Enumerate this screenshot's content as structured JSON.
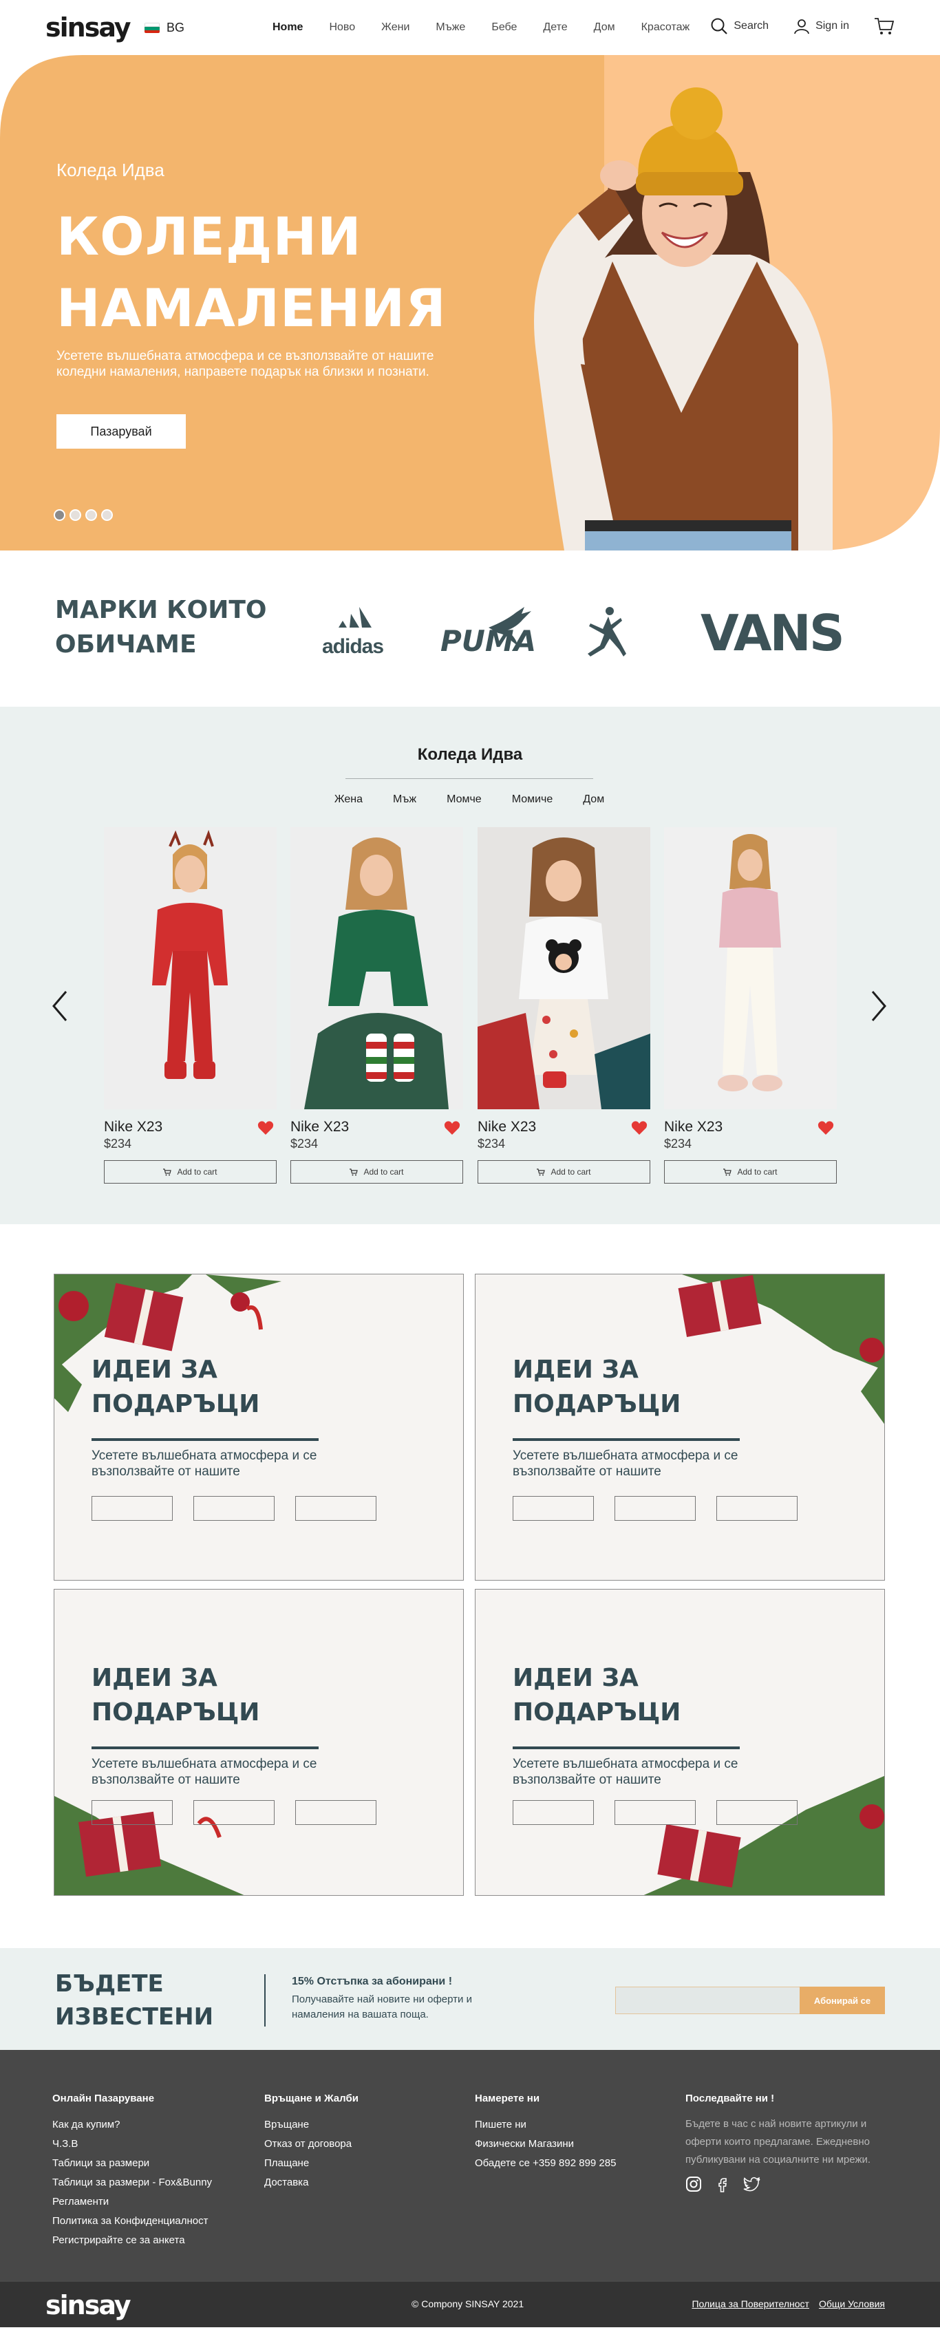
{
  "header": {
    "logo": "sinsay",
    "lang": "BG",
    "nav": [
      "Home",
      "Ново",
      "Жени",
      "Мъже",
      "Бебе",
      "Дете",
      "Дом",
      "Красотаж"
    ],
    "search_label": "Search",
    "signin_label": "Sign in"
  },
  "hero": {
    "subtitle": "Коледа Идва",
    "title_line1": "КОЛЕДНИ",
    "title_line2": "НАМАЛЕНИЯ",
    "description": "Усетете вълшебната атмосфера и се възползвайте от нашите коледни намаления, направете подарък на близки и познати.",
    "cta": "Пазарувай",
    "slides_total": 4,
    "active_slide": 1
  },
  "brands": {
    "title_line1": "МАРКИ КОИТО",
    "title_line2": "ОБИЧАМЕ",
    "logos": [
      "adidas",
      "PUMA",
      "jordan-jumpman-logo",
      "VANS"
    ]
  },
  "collection": {
    "title": "Коледа Идва",
    "tabs": [
      "Жена",
      "Мъж",
      "Момче",
      "Момиче",
      "Дом"
    ],
    "products": [
      {
        "name": "Nike X23",
        "price": "$234",
        "cart": "Add to cart"
      },
      {
        "name": "Nike X23",
        "price": "$234",
        "cart": "Add to cart"
      },
      {
        "name": "Nike X23",
        "price": "$234",
        "cart": "Add to cart"
      },
      {
        "name": "Nike X23",
        "price": "$234",
        "cart": "Add to cart"
      }
    ]
  },
  "gifts": {
    "title_line1": "ИДЕИ ЗА",
    "title_line2": "ПОДАРЪЦИ",
    "description": "Усетете вълшебната атмосфера и се възползвайте от нашите"
  },
  "newsletter": {
    "title_line1": "БЪДЕТЕ",
    "title_line2": "ИЗВЕСТЕНИ",
    "headline": "15% Отстъпка за абонирани !",
    "text": "Получавайте най новите ни оферти и намаления на вашата поща.",
    "button": "Абонирай се"
  },
  "footer": {
    "col1": {
      "title": "Онлайн Пазаруване",
      "links": [
        "Как да купим?",
        "Ч.З.В",
        "Таблици за размери",
        "Таблици за размери - Fox&Bunny",
        "Регламенти",
        "Политика за Конфиденциалност",
        "Регистрирайте се за анкета"
      ]
    },
    "col2": {
      "title": "Връщане и Жалби",
      "links": [
        "Връщане",
        "Отказ от договора",
        "Плащане",
        "Доставка"
      ]
    },
    "col3": {
      "title": "Намерете ни",
      "links": [
        "Пишете ни",
        "Физически Магазини",
        "Обадете се +359 892 899 285"
      ]
    },
    "col4": {
      "title": "Последвайте ни !",
      "text": "Бъдете в час с най новите артикули и оферти които предлагаме. Ежедневно публикувани на социалните ни мрежи."
    },
    "copyright": "© Compony SINSAY 2021",
    "links": [
      "Полица за Поверителност",
      "Общи Условия"
    ]
  },
  "colors": {
    "accent": "#f3b56d",
    "brand_dark": "#334a52",
    "footer": "#484848"
  }
}
